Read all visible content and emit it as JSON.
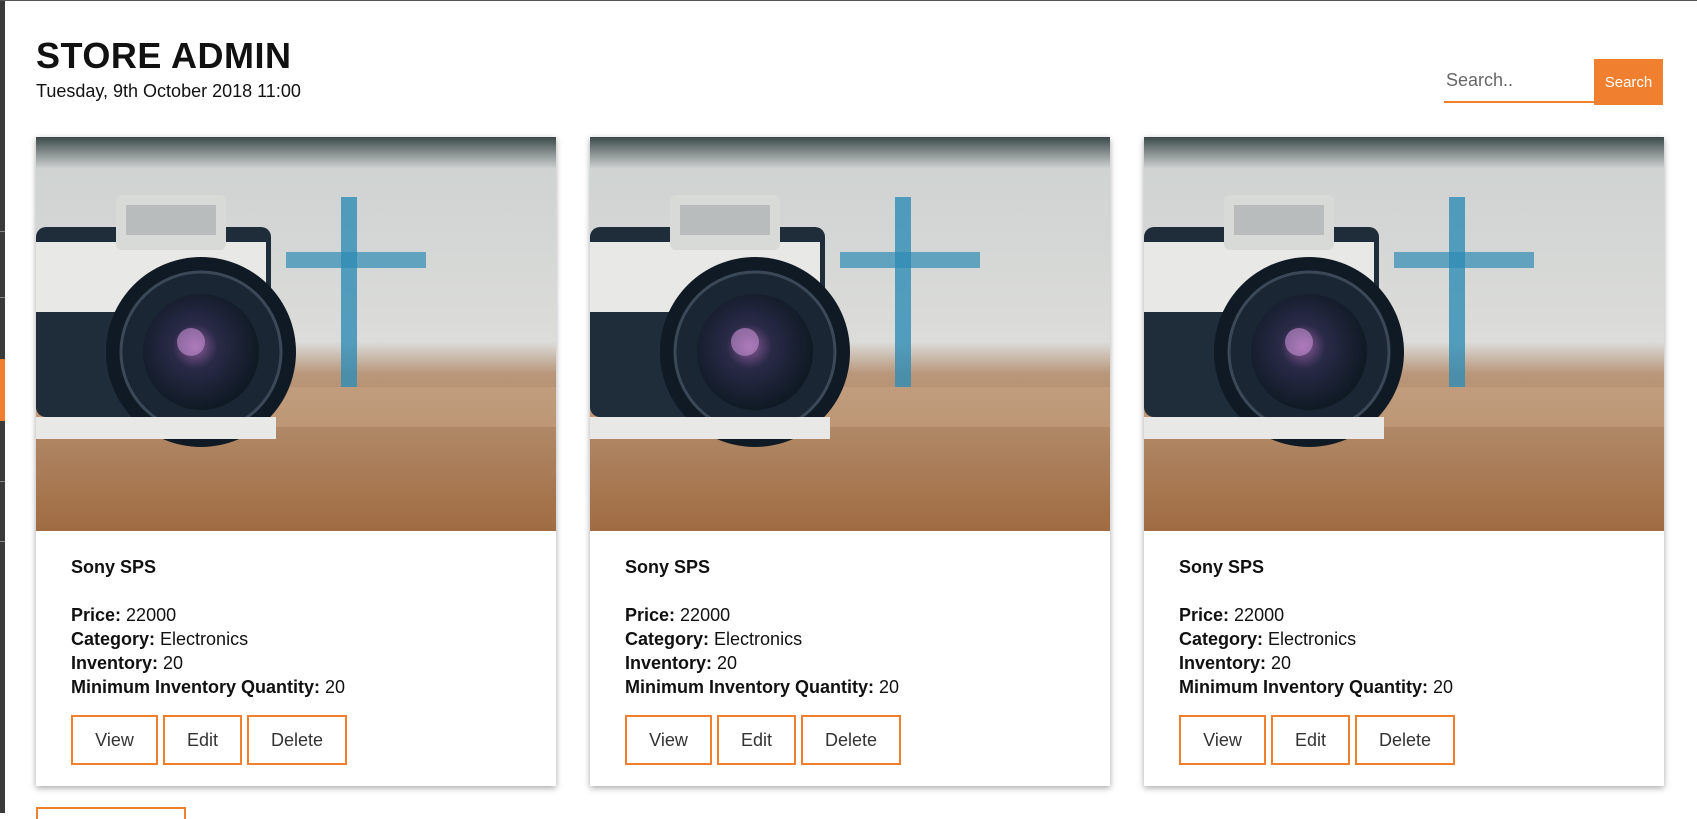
{
  "header": {
    "title": "STORE ADMIN",
    "date": "Tuesday, 9th October 2018 11:00"
  },
  "search": {
    "placeholder": "Search..",
    "value": "",
    "button_label": "Search"
  },
  "theme": {
    "accent": "#f08030",
    "text": "#111111"
  },
  "products": [
    {
      "image": "camera-photo",
      "name": "Sony SPS",
      "price_label": "Price:",
      "price": "22000",
      "category_label": "Category:",
      "category": "Electronics",
      "inventory_label": "Inventory:",
      "inventory": "20",
      "min_inventory_label": "Minimum Inventory Quantity:",
      "min_inventory": "20",
      "view_label": "View",
      "edit_label": "Edit",
      "delete_label": "Delete"
    },
    {
      "image": "camera-photo",
      "name": "Sony SPS",
      "price_label": "Price:",
      "price": "22000",
      "category_label": "Category:",
      "category": "Electronics",
      "inventory_label": "Inventory:",
      "inventory": "20",
      "min_inventory_label": "Minimum Inventory Quantity:",
      "min_inventory": "20",
      "view_label": "View",
      "edit_label": "Edit",
      "delete_label": "Delete"
    },
    {
      "image": "camera-photo",
      "name": "Sony SPS",
      "price_label": "Price:",
      "price": "22000",
      "category_label": "Category:",
      "category": "Electronics",
      "inventory_label": "Inventory:",
      "inventory": "20",
      "min_inventory_label": "Minimum Inventory Quantity:",
      "min_inventory": "20",
      "view_label": "View",
      "edit_label": "Edit",
      "delete_label": "Delete"
    }
  ]
}
